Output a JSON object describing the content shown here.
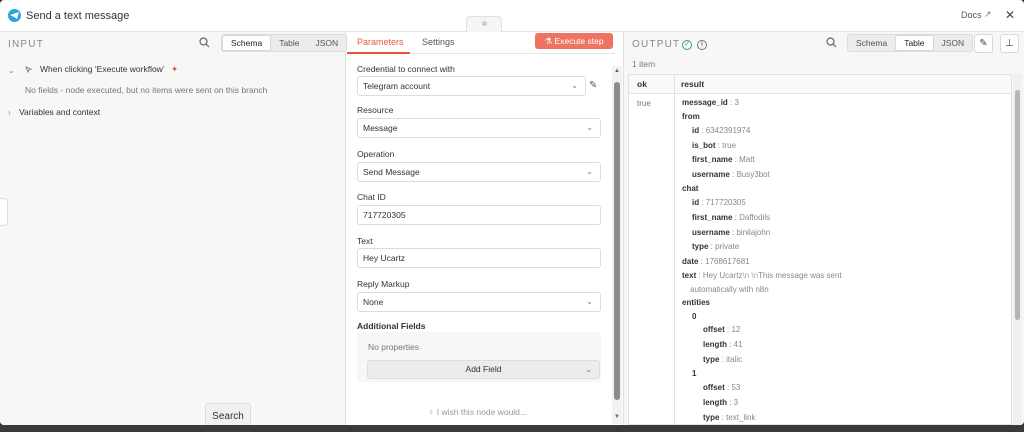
{
  "header": {
    "title": "Send a text message",
    "docs_label": "Docs",
    "close_symbol": "✕"
  },
  "input": {
    "panel_title": "INPUT",
    "view_tabs": [
      "Schema",
      "Table",
      "JSON"
    ],
    "active_view": "Schema",
    "trigger_label": "When clicking ‘Execute workflow’",
    "empty_message": "No fields - node executed, but no items were sent on this branch",
    "variables_label": "Variables and context",
    "search_tooltip": "Search"
  },
  "parameters": {
    "tabs": [
      "Parameters",
      "Settings"
    ],
    "active_tab": "Parameters",
    "execute_label": "Execute step",
    "credential_label": "Credential to connect with",
    "credential_value": "Telegram account",
    "resource_label": "Resource",
    "resource_value": "Message",
    "operation_label": "Operation",
    "operation_value": "Send Message",
    "chat_id_label": "Chat ID",
    "chat_id_value": "717720305",
    "text_label": "Text",
    "text_value": "Hey Ucartz",
    "reply_markup_label": "Reply Markup",
    "reply_markup_value": "None",
    "additional_fields_label": "Additional Fields",
    "no_properties": "No properties",
    "add_field_label": "Add Field",
    "wish_label": "I wish this node would..."
  },
  "output": {
    "panel_title": "OUTPUT",
    "item_count": "1 item",
    "view_tabs": [
      "Schema",
      "Table",
      "JSON"
    ],
    "active_view": "Table",
    "columns": [
      "ok",
      "result"
    ],
    "ok_value": "true",
    "result": {
      "message_id_key": "message_id",
      "message_id": "3",
      "from_key": "from",
      "from_id_key": "id",
      "from_id": "6342391974",
      "is_bot_key": "is_bot",
      "is_bot": "true",
      "first_name_key": "first_name",
      "from_first_name": "Matt",
      "username_key": "username",
      "from_username": "Busy3bot",
      "chat_key": "chat",
      "chat_id_key": "id",
      "chat_id": "717720305",
      "chat_first_name": "Daffodils",
      "chat_username": "binilajohn",
      "type_key": "type",
      "chat_type": "private",
      "date_key": "date",
      "date": "1768617681",
      "text_key": "text",
      "text_part1": "Hey Ucartz",
      "text_newlines": "\\n \\n",
      "text_part2": "This message was sent",
      "text_part3": "automatically with n8n",
      "entities_key": "entities",
      "e0_index": "0",
      "offset_key": "offset",
      "e0_offset": "12",
      "length_key": "length",
      "e0_length": "41",
      "e0_type": "italic",
      "e1_index": "1",
      "e1_offset": "53",
      "e1_length": "3",
      "e1_type": "text_link"
    }
  },
  "colors": {
    "accent": "#e6553a",
    "execute_button": "#ee7461",
    "success": "#2fa66a",
    "telegram": "#2aa3df"
  }
}
